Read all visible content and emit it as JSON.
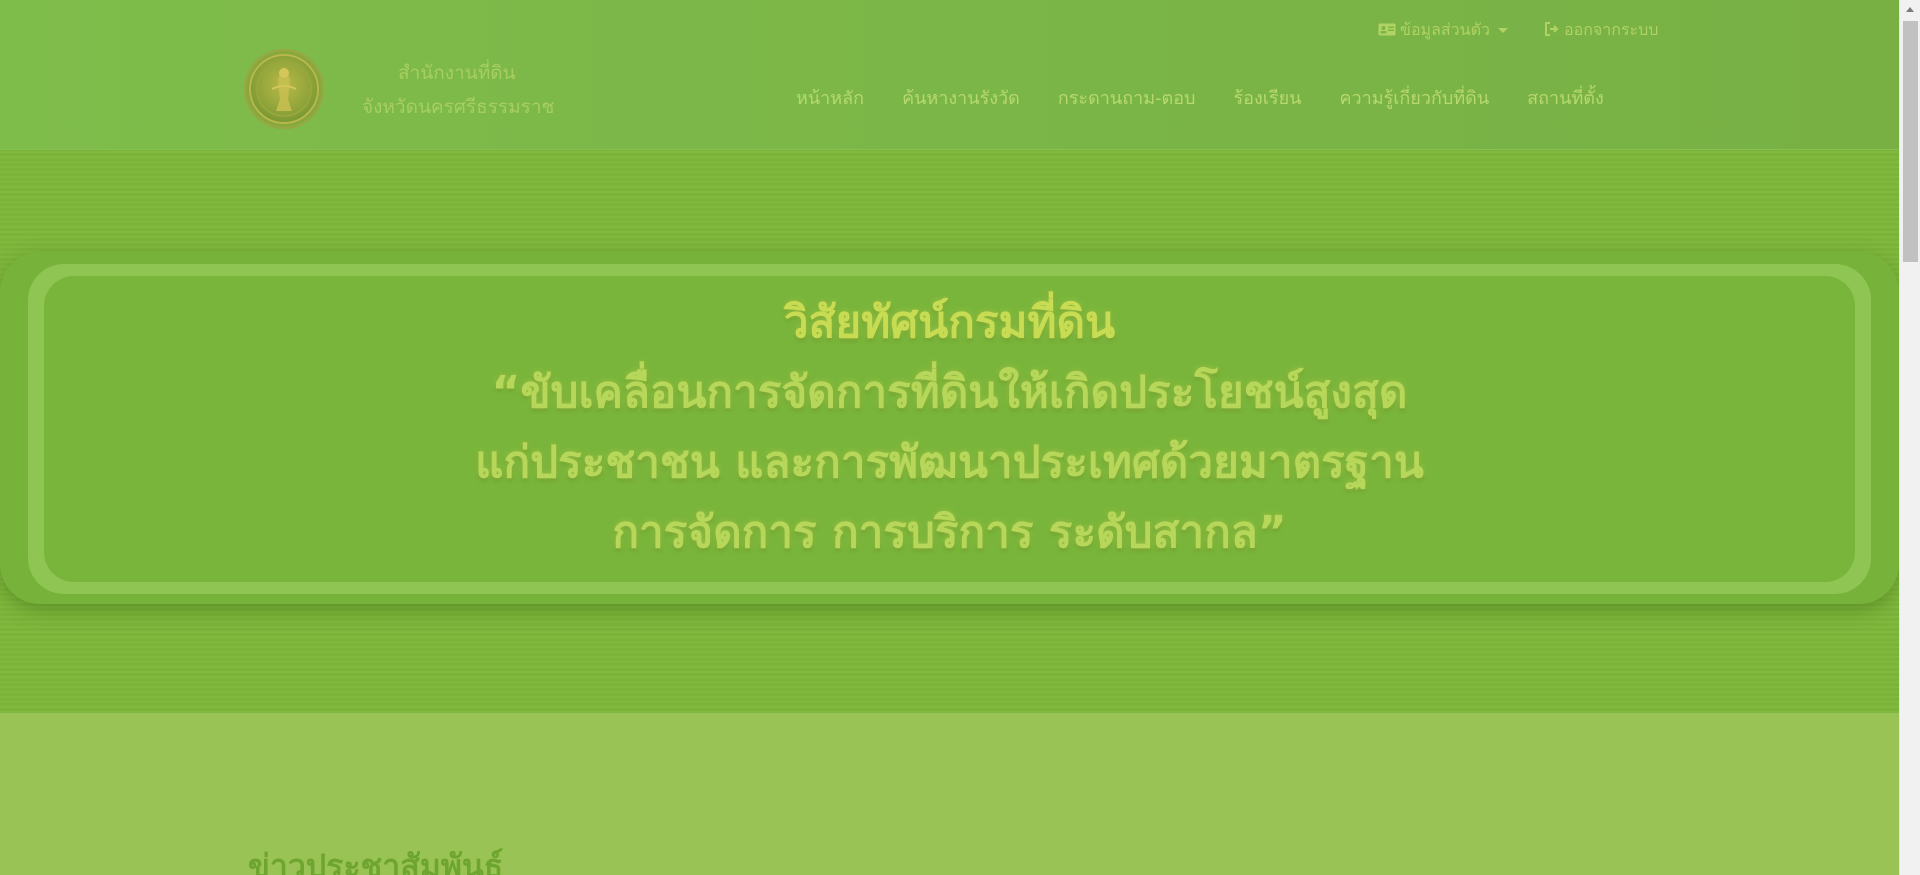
{
  "header": {
    "org_line1": "สำนักงานที่ดิน",
    "org_line2": "จังหวัดนครศรีธรรมราช",
    "logo_icon": "land-department-seal",
    "profile_label": "ข้อมูลส่วนตัว",
    "logout_label": "ออกจากระบบ"
  },
  "nav": {
    "items": [
      {
        "label": "หน้าหลัก"
      },
      {
        "label": "ค้นหางานรังวัด"
      },
      {
        "label": "กระดานถาม-ตอบ"
      },
      {
        "label": "ร้องเรียน"
      },
      {
        "label": "ความรู้เกี่ยวกับที่ดิน"
      },
      {
        "label": "สถานที่ตั้ง"
      }
    ]
  },
  "hero": {
    "title": "วิสัยทัศน์กรมที่ดิน",
    "line1": "“ขับเคลื่อนการจัดการที่ดินให้เกิดประโยชน์สูงสุด",
    "line2": "แก่ประชาชน และการพัฒนาประเทศด้วยมาตรฐาน",
    "line3": "การจัดการ การบริการ ระดับสากล”"
  },
  "section": {
    "title": "ข่าวประชาสัมพันธ์"
  },
  "colors": {
    "overlay_green": "#7db73a",
    "page_green": "#99c455"
  }
}
